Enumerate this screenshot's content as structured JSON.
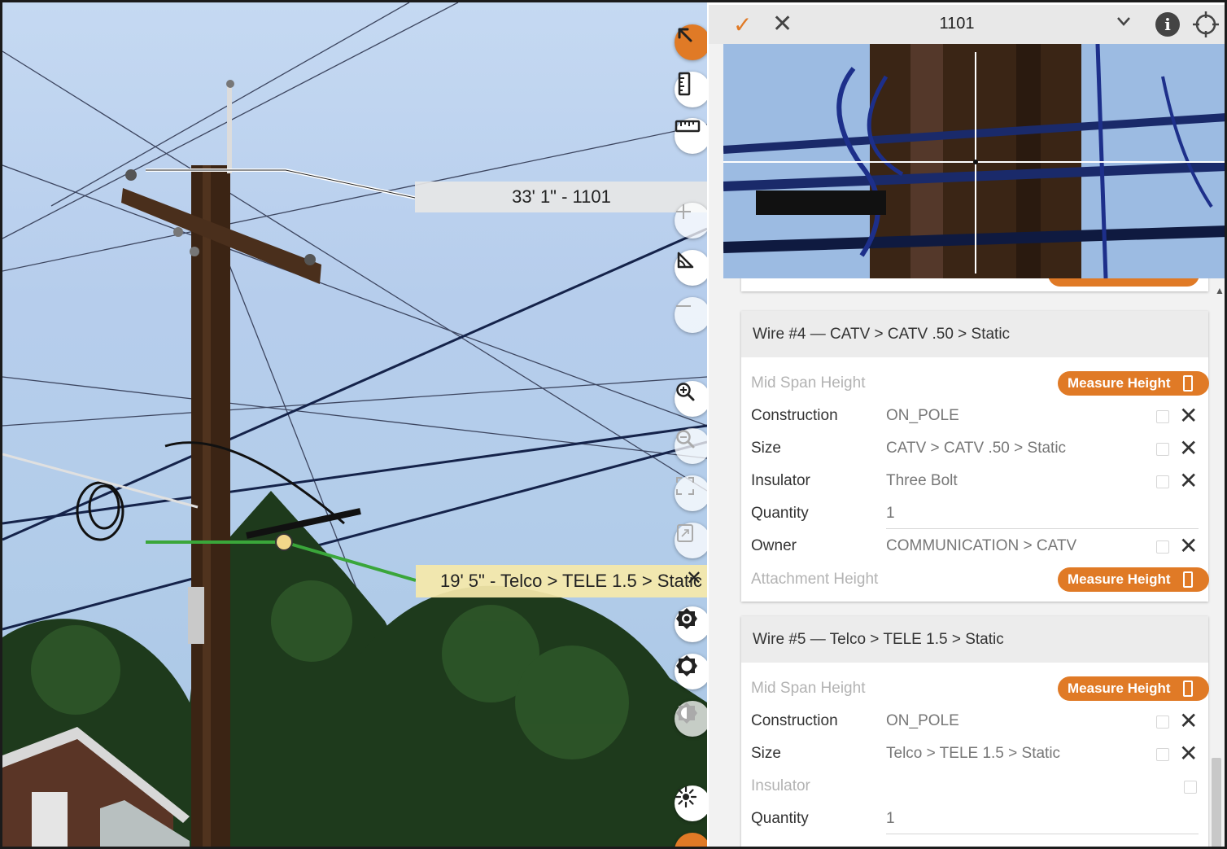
{
  "photo": {
    "label_top": "33' 1\" - 1101",
    "label_bottom": "19' 5\" - Telco > TELE 1.5 > Static",
    "label_bottom_close": "✕"
  },
  "toolbar": {
    "items": [
      "select-arrow",
      "height-ruler",
      "horizontal-ruler",
      "add",
      "angle",
      "remove",
      "zoom-in",
      "zoom-out",
      "fit-screen",
      "fullscreen",
      "brightness-high",
      "brightness-low",
      "contrast",
      "sun-settings"
    ]
  },
  "panel": {
    "header": {
      "check": "✓",
      "close": "✕",
      "title": "1101"
    },
    "cards": [
      {
        "title": "Wire #4 — CATV > CATV .50 > Static",
        "mid_span_label": "Mid Span Height",
        "measure_label": "Measure Height",
        "rows": [
          {
            "label": "Construction",
            "value": "ON_POLE"
          },
          {
            "label": "Size",
            "value": "CATV > CATV .50 > Static"
          },
          {
            "label": "Insulator",
            "value": "Three Bolt"
          },
          {
            "label": "Quantity",
            "value": "1"
          },
          {
            "label": "Owner",
            "value": "COMMUNICATION > CATV"
          }
        ],
        "attachment_label": "Attachment Height",
        "attachment_measure_label": "Measure Height"
      },
      {
        "title": "Wire #5 — Telco > TELE 1.5 > Static",
        "mid_span_label": "Mid Span Height",
        "measure_label": "Measure Height",
        "rows": [
          {
            "label": "Construction",
            "value": "ON_POLE"
          },
          {
            "label": "Size",
            "value": "Telco > TELE 1.5 > Static"
          },
          {
            "label": "Insulator",
            "value": ""
          },
          {
            "label": "Quantity",
            "value": "1"
          }
        ]
      }
    ]
  },
  "colors": {
    "accent": "#e07a26",
    "highlight_wire": "#3aa63a",
    "label_bg": "#f5e8aa"
  }
}
